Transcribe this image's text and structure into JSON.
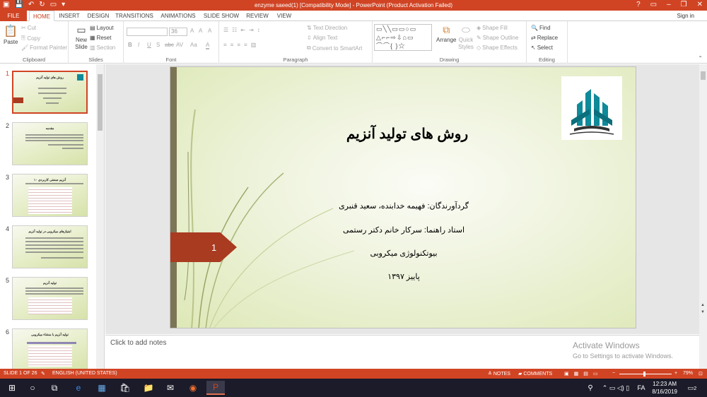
{
  "window": {
    "title": "enzyme saeed(1) [Compatibility Mode] - PowerPoint (Product Activation Failed)",
    "help": "?",
    "min": "–",
    "restore": "❐",
    "close": "✕"
  },
  "tabs": [
    "FILE",
    "HOME",
    "INSERT",
    "DESIGN",
    "TRANSITIONS",
    "ANIMATIONS",
    "SLIDE SHOW",
    "REVIEW",
    "VIEW"
  ],
  "active_tab": "HOME",
  "signin": "Sign in",
  "ribbon": {
    "clipboard": {
      "paste": "Paste",
      "cut": "Cut",
      "copy": "Copy",
      "format_painter": "Format Painter",
      "label": "Clipboard"
    },
    "slides": {
      "new_slide": "New Slide",
      "layout": "Layout",
      "reset": "Reset",
      "section": "Section",
      "label": "Slides"
    },
    "font": {
      "size": "36",
      "bold": "B",
      "italic": "I",
      "underline": "U",
      "strike": "S",
      "shadow": "abc",
      "spacing": "AV",
      "case": "Aa",
      "color": "A",
      "grow": "A",
      "shrink": "A",
      "clear": "A",
      "label": "Font"
    },
    "paragraph": {
      "text_direction": "Text Direction",
      "align_text": "Align Text",
      "smartart": "Convert to SmartArt",
      "label": "Paragraph"
    },
    "drawing": {
      "arrange": "Arrange",
      "quick_styles": "Quick Styles",
      "shape_fill": "Shape Fill",
      "shape_outline": "Shape Outline",
      "shape_effects": "Shape Effects",
      "label": "Drawing"
    },
    "editing": {
      "find": "Find",
      "replace": "Replace",
      "select": "Select",
      "label": "Editing"
    }
  },
  "thumbnails": [
    {
      "num": "1",
      "title": "روش های تولید آنزیم"
    },
    {
      "num": "2",
      "title": "مقدمه"
    },
    {
      "num": "3",
      "title": "۱۰ آنزیم صنعتی کاربردی"
    },
    {
      "num": "4",
      "title": "امتیازهای میکروبی در تولید آنزیم"
    },
    {
      "num": "5",
      "title": "تولید آنزیم"
    },
    {
      "num": "6",
      "title": "تولید آنزیم با منشاء میکروبی"
    }
  ],
  "slide": {
    "number": "1",
    "title": "روش های تولید آنزیم",
    "lines": [
      "گردآورندگان: فهیمه خدابنده، سعید قنبری",
      "استاد راهنما: سرکار خانم دکتر رستمی",
      "بیوتکنولوژی میکروبی",
      "پاییز ۱۳۹۷"
    ]
  },
  "notes_placeholder": "Click to add notes",
  "activation": {
    "title": "Activate Windows",
    "subtitle": "Go to Settings to activate Windows."
  },
  "status": {
    "slide": "SLIDE 1 OF 26",
    "language": "ENGLISH (UNITED STATES)",
    "notes": "NOTES",
    "comments": "COMMENTS",
    "zoom": "79%"
  },
  "taskbar": {
    "time": "12:23 AM",
    "date": "8/16/2019",
    "lang": "FA",
    "notif": "2"
  }
}
